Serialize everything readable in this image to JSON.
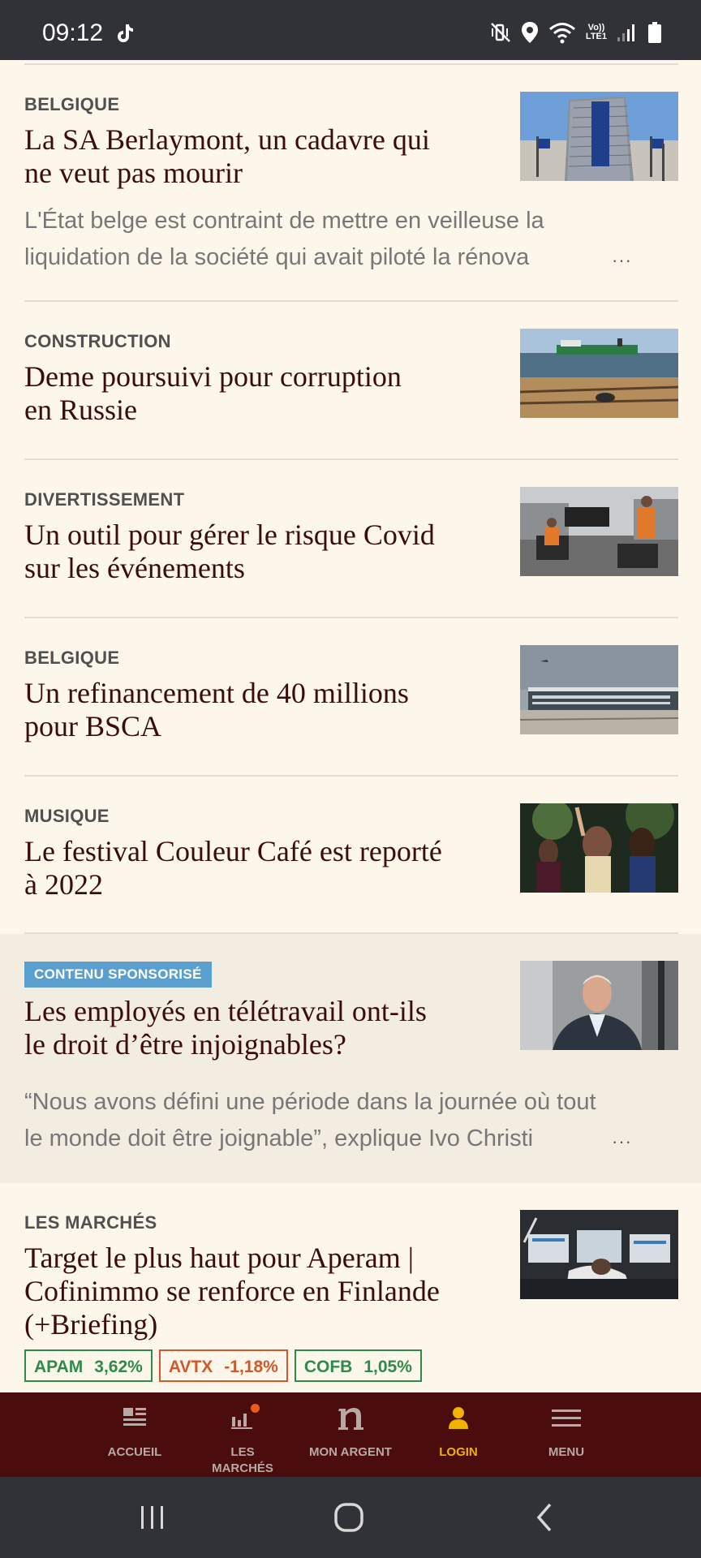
{
  "status_bar": {
    "time": "09:12",
    "lte_label": "Vo))\nLTE1",
    "icons": [
      "tiktok-icon",
      "mute-vibrate-icon",
      "location-icon",
      "wifi-icon",
      "lte-icon",
      "signal-icon",
      "battery-icon"
    ]
  },
  "articles": [
    {
      "category": "BELGIQUE",
      "title_line1": "La SA Berlaymont, un cadavre qui",
      "title_line2": "ne veut pas mourir",
      "summary_line1": "L'État belge est contraint de mettre en veilleuse la",
      "summary_line2": "liquidation de la société qui avait piloté la rénova",
      "thumb": "berlaymont-building-image"
    },
    {
      "category": "CONSTRUCTION",
      "title_line1": "Deme poursuivi pour corruption",
      "title_line2": "en Russie",
      "thumb": "dredging-ship-beach-image"
    },
    {
      "category": "DIVERTISSEMENT",
      "title_line1": "Un outil pour gérer le risque Covid",
      "title_line2": "sur les événements",
      "thumb": "event-workers-protest-image"
    },
    {
      "category": "BELGIQUE",
      "title_line1": "Un refinancement de 40 millions",
      "title_line2": "pour BSCA",
      "thumb": "airport-terminal-image"
    },
    {
      "category": "MUSIQUE",
      "title_line1": "Le festival Couleur Café est reporté",
      "title_line2": "à 2022",
      "thumb": "festival-crowd-image"
    }
  ],
  "sponsored": {
    "badge": "CONTENU SPONSORISÉ",
    "title_line1": "Les employés en télétravail ont-ils",
    "title_line2": "le droit d’être injoignables?",
    "summary_line1": "“Nous avons défini une période dans la journée où tout",
    "summary_line2": "le monde doit être joignable”, explique Ivo Christi",
    "thumb": "businessman-portrait-image"
  },
  "markets_article": {
    "category": "LES MARCHÉS",
    "title_line1": "Target le plus haut pour Aperam |",
    "title_line2": "Cofinimmo se renforce en Finlande",
    "title_line3": "(+Briefing)",
    "thumb": "trading-floor-image",
    "tickers": [
      {
        "symbol": "APAM",
        "value": "3,62%",
        "trend": "up"
      },
      {
        "symbol": "AVTX",
        "value": "-1,18%",
        "trend": "down"
      },
      {
        "symbol": "COFB",
        "value": "1,05%",
        "trend": "up"
      }
    ]
  },
  "ellipsis": "···",
  "bottom_nav": {
    "items": [
      {
        "label": "ACCUEIL",
        "icon": "newspaper-icon"
      },
      {
        "label_line1": "LES",
        "label_line2": "MARCHÉS",
        "icon": "bar-chart-icon"
      },
      {
        "label": "MON ARGENT",
        "icon": "n-logo-icon"
      },
      {
        "label": "LOGIN",
        "icon": "user-icon",
        "active": true
      },
      {
        "label": "MENU",
        "icon": "hamburger-icon"
      }
    ],
    "active_color": "#f0b400",
    "background": "#4a0c0c"
  },
  "colors": {
    "page_background": "#fdf6ea",
    "title": "#3a0d0c",
    "positive": "#2e8b4a",
    "negative": "#d0582c",
    "sponsored_badge": "#5b9fcf"
  }
}
